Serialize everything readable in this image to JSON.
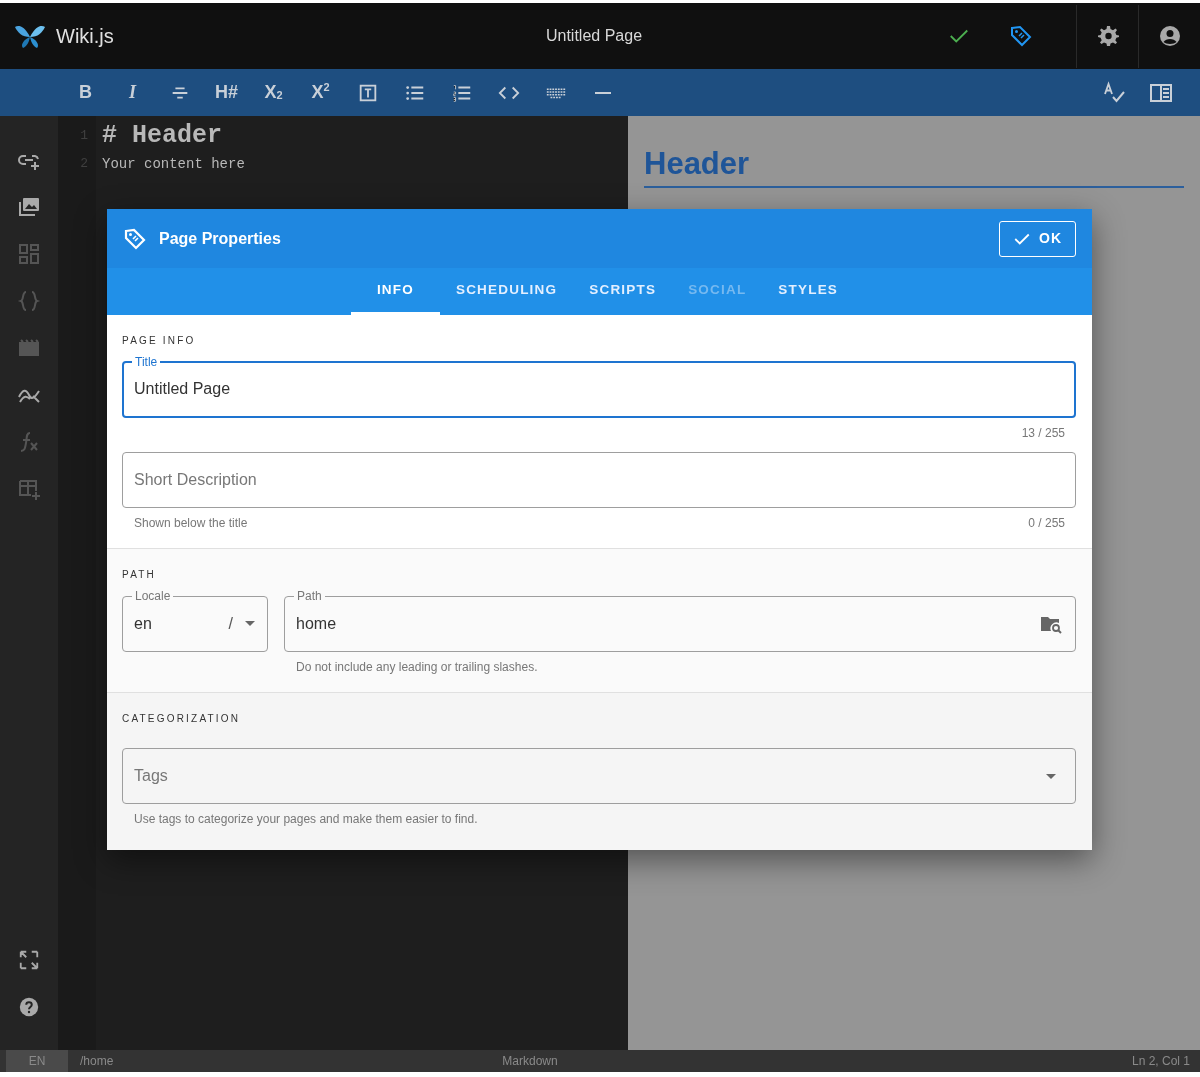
{
  "app": {
    "logo_text": "Wiki.js",
    "page_title": "Untitled Page"
  },
  "toolbar": [
    {
      "kind": "bold",
      "label": "B"
    },
    {
      "kind": "italic",
      "label": "I"
    },
    {
      "kind": "strikethrough"
    },
    {
      "kind": "heading",
      "label": "H#"
    },
    {
      "kind": "subscript",
      "label": "X$_{2}$"
    },
    {
      "kind": "superscript",
      "label": "X$^{2}$"
    },
    {
      "kind": "text-box"
    },
    {
      "kind": "bullets"
    },
    {
      "kind": "numbered"
    },
    {
      "kind": "code"
    },
    {
      "kind": "keyboard"
    },
    {
      "kind": "rule"
    }
  ],
  "editor": {
    "lines": [
      {
        "number": "1",
        "text": "# Header",
        "kind": "heading"
      },
      {
        "number": "2",
        "text": "Your content here",
        "kind": "body"
      }
    ]
  },
  "preview": {
    "heading": "Header"
  },
  "dialog": {
    "title": "Page Properties",
    "ok_button": "OK",
    "tabs": [
      {
        "label": "INFO",
        "selected": true,
        "disabled": false
      },
      {
        "label": "SCHEDULING",
        "selected": false,
        "disabled": false
      },
      {
        "label": "SCRIPTS",
        "selected": false,
        "disabled": false
      },
      {
        "label": "SOCIAL",
        "selected": false,
        "disabled": true
      },
      {
        "label": "STYLES",
        "selected": false,
        "disabled": false
      }
    ],
    "page_info": {
      "heading": "PAGE INFO",
      "title_field": {
        "label": "Title",
        "value": "Untitled Page",
        "focused": true,
        "counter": "13 / 255"
      },
      "description_field": {
        "placeholder": "Short Description",
        "hint": "Shown below the title",
        "counter": "0 / 255"
      }
    },
    "path": {
      "heading": "PATH",
      "locale_field": {
        "label": "Locale",
        "value": "en",
        "separator": "/"
      },
      "path_field": {
        "label": "Path",
        "value": "home",
        "hint": "Do not include any leading or trailing slashes."
      }
    },
    "categorization": {
      "heading": "CATEGORIZATION",
      "tags_field": {
        "placeholder": "Tags",
        "hint": "Use tags to categorize your pages and make them easier to find."
      }
    }
  },
  "status_bar": {
    "locale": "EN",
    "path": "/home",
    "mode": "Markdown",
    "position": "Ln 2, Col 1"
  }
}
